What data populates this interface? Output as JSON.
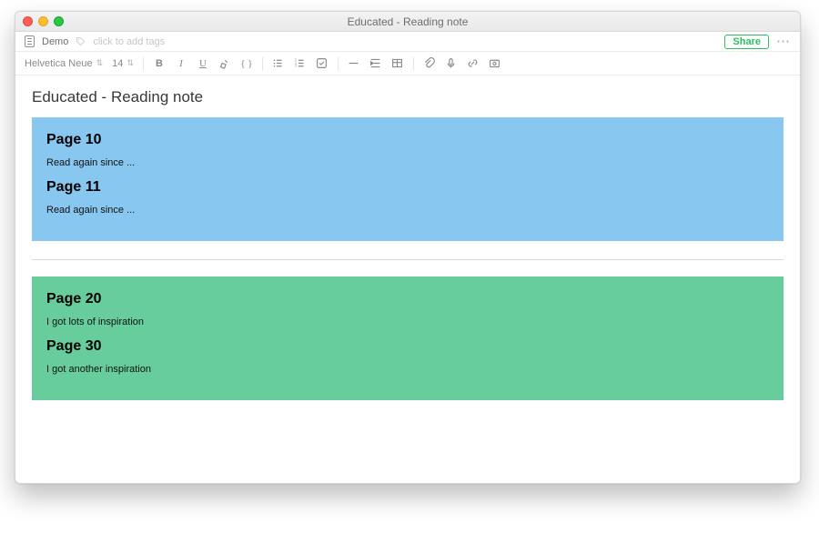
{
  "window": {
    "title": "Educated - Reading note"
  },
  "header": {
    "notebook": "Demo",
    "tags_placeholder": "click to add tags",
    "share_label": "Share"
  },
  "toolbar": {
    "font_name": "Helvetica Neue",
    "font_size": "14"
  },
  "note": {
    "title": "Educated - Reading note",
    "blocks": [
      {
        "color": "blue",
        "items": [
          {
            "heading": "Page 10",
            "body": "Read again since ..."
          },
          {
            "heading": "Page 11",
            "body": "Read again since ..."
          }
        ]
      },
      {
        "color": "green",
        "items": [
          {
            "heading": "Page 20",
            "body": "I got lots of inspiration"
          },
          {
            "heading": "Page 30",
            "body": "I got another inspiration"
          }
        ]
      }
    ]
  }
}
